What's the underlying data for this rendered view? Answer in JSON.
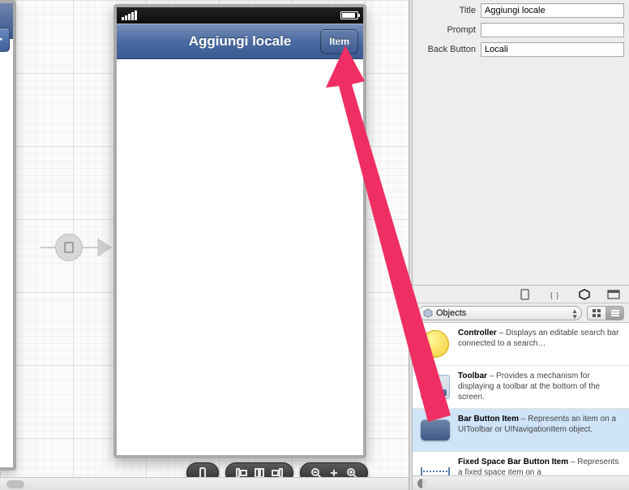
{
  "inspector": {
    "title_label": "Title",
    "title_value": "Aggiungi locale",
    "prompt_label": "Prompt",
    "prompt_value": "",
    "back_label": "Back Button",
    "back_value": "Locali"
  },
  "nav": {
    "title": "Aggiungi locale",
    "right_button": "Item"
  },
  "library": {
    "dropdown": "Objects",
    "items": [
      {
        "title": "Controller",
        "desc": " – Displays an editable search bar connected to a search…"
      },
      {
        "title": "Toolbar",
        "desc": " – Provides a mechanism for displaying a toolbar at the bottom of the screen."
      },
      {
        "title": "Bar Button Item",
        "desc": " – Represents an item on a UIToolbar or UINavigationItem object."
      },
      {
        "title": "Fixed Space Bar Button Item",
        "desc": " – Represents a fixed space item on a"
      }
    ]
  }
}
